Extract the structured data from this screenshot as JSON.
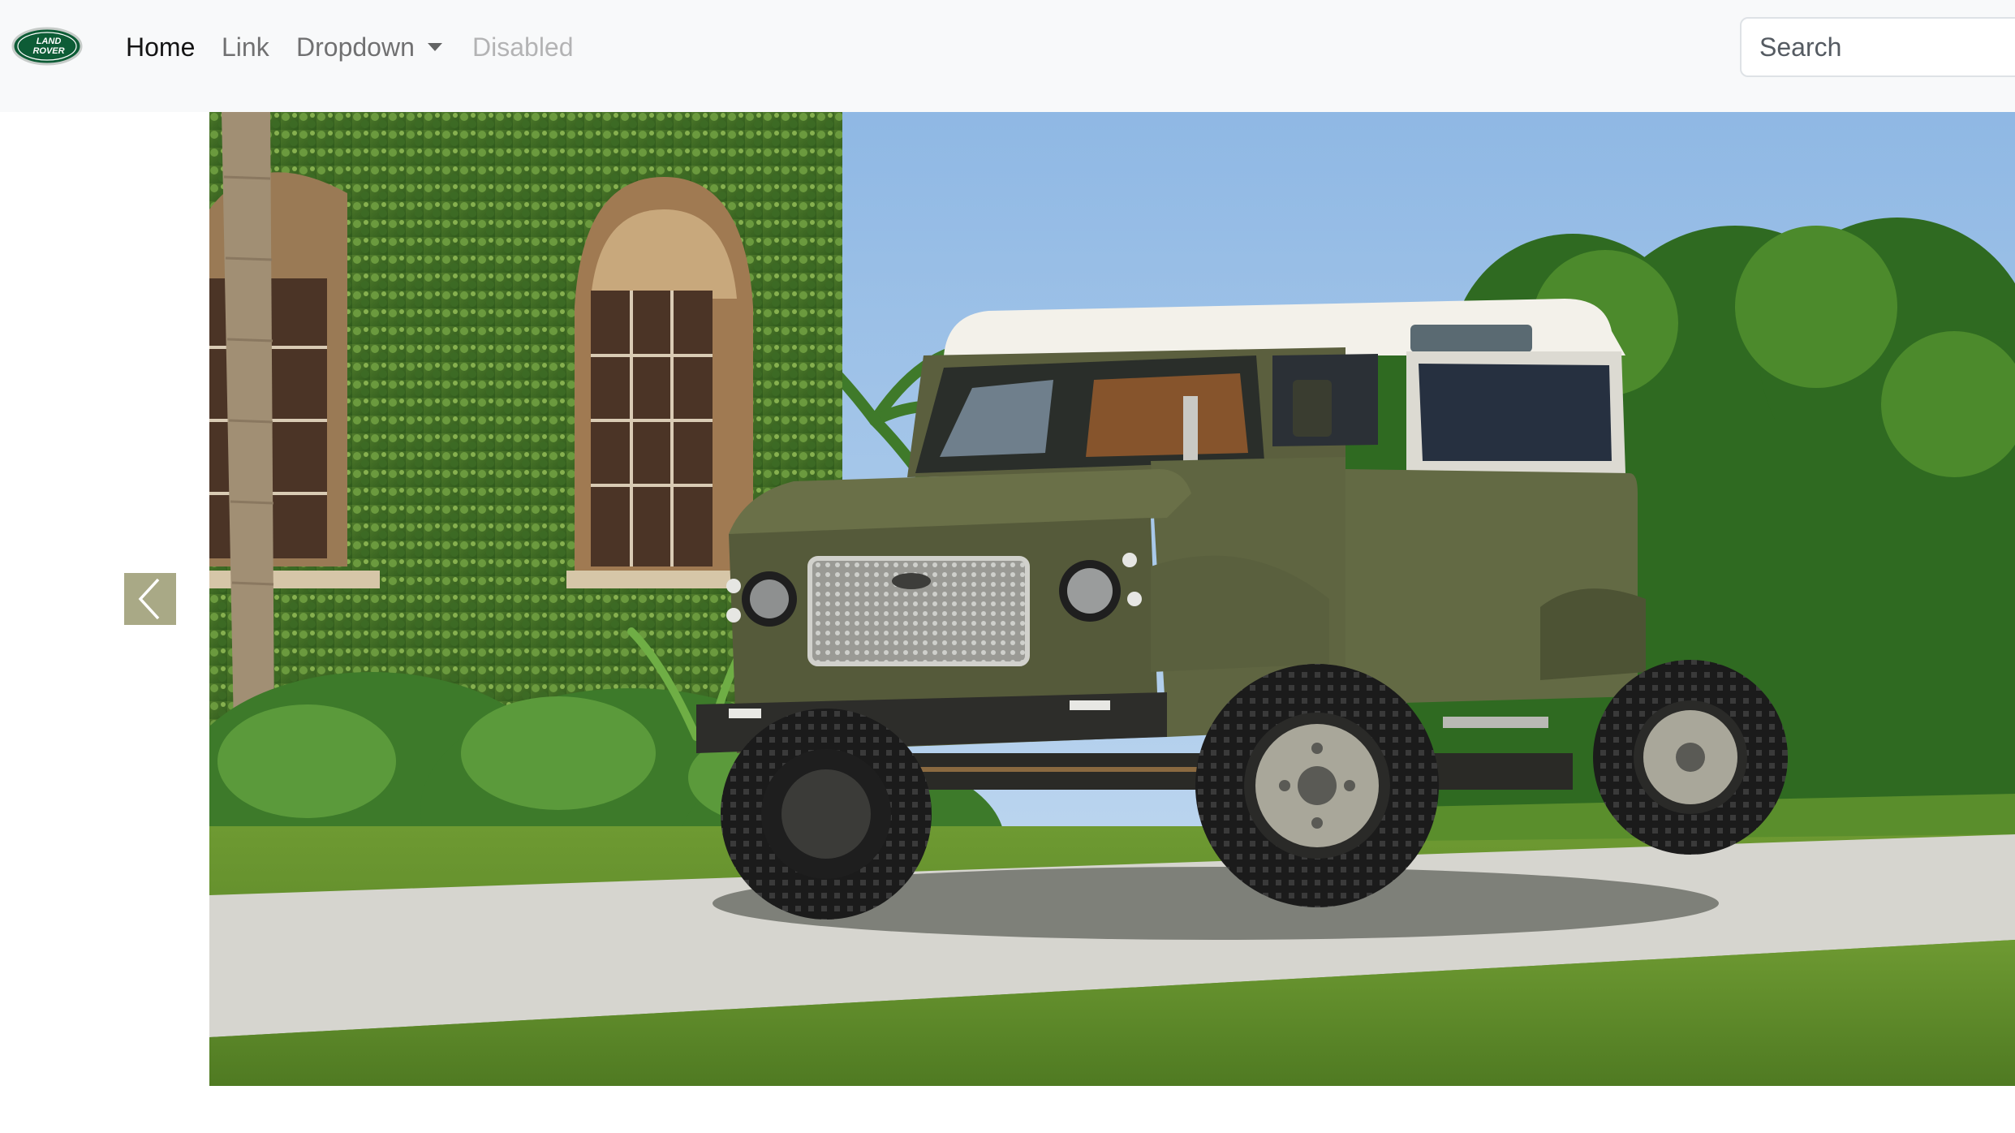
{
  "navbar": {
    "brand": {
      "logo": "land-rover-logo",
      "logo_text_line1": "LAND",
      "logo_text_line2": "ROVER",
      "color": "#0d5c36"
    },
    "items": [
      {
        "label": "Home",
        "state": "active"
      },
      {
        "label": "Link",
        "state": "normal"
      },
      {
        "label": "Dropdown",
        "state": "dropdown"
      },
      {
        "label": "Disabled",
        "state": "disabled"
      }
    ],
    "search": {
      "placeholder": "Search",
      "value": ""
    },
    "background": "#f8f9fa"
  },
  "carousel": {
    "slide_image": "olive-green-land-rover-defender-90-photo",
    "prev_icon": "chevron-left-icon",
    "control_color": "#a9a986"
  }
}
